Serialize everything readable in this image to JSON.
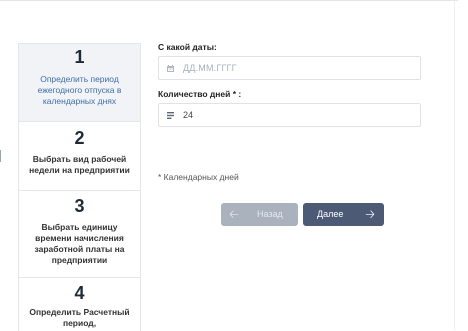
{
  "steps": [
    {
      "number": "1",
      "label": "Определить период ежегодного отпуска в календарных днях",
      "active": true
    },
    {
      "number": "2",
      "label": "Выбрать вид рабочей недели на предприятии",
      "active": false
    },
    {
      "number": "3",
      "label": "Выбрать единицу времени начисления заработной платы на предприятии",
      "active": false
    },
    {
      "number": "4",
      "label": "Определить Расчетный период,",
      "active": false
    }
  ],
  "form": {
    "date_label": "С какой даты:",
    "date_placeholder": "ДД.ММ.ГГГГ",
    "date_icon": "calendar-icon",
    "days_label": "Количество дней * :",
    "days_value": "24",
    "days_icon": "number-icon",
    "note": "* Календарных дней"
  },
  "buttons": {
    "back_label": "Назад",
    "back_icon": "arrow-left-icon",
    "next_label": "Далее",
    "next_icon": "arrow-right-icon"
  },
  "colors": {
    "active_step_text": "#3f6fa8",
    "next_button": "#4d5a75",
    "back_button_disabled": "#aab2be"
  }
}
